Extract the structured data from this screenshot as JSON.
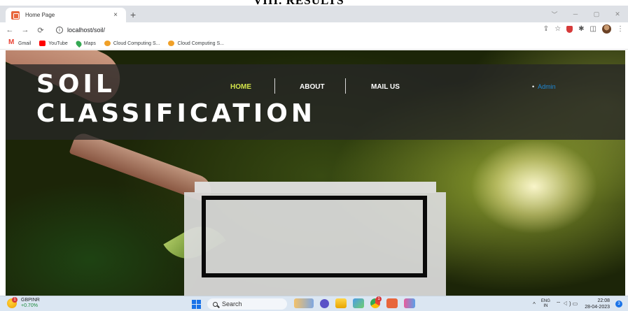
{
  "document": {
    "heading": "VIII.    RESULTS"
  },
  "browser": {
    "tab_title": "Home Page",
    "tab_close": "×",
    "new_tab": "+",
    "url": "localhost/soil/",
    "bookmarks": [
      {
        "label": "Gmail",
        "icon": "gmail-icon"
      },
      {
        "label": "YouTube",
        "icon": "youtube-icon"
      },
      {
        "label": "Maps",
        "icon": "maps-icon"
      },
      {
        "label": "Cloud Computing S...",
        "icon": "cloud-icon"
      },
      {
        "label": "Cloud Computing S...",
        "icon": "cloud-icon"
      }
    ]
  },
  "site": {
    "brand_line1": "SOIL",
    "brand_line2": "CLASSIFICATION",
    "nav": {
      "home": "HOME",
      "about": "ABOUT",
      "mail": "MAIL US"
    },
    "admin": "Admin",
    "colors": {
      "nav_active": "#d4e44a",
      "admin_link": "#1e88d6",
      "header_band": "#262626"
    }
  },
  "taskbar": {
    "ticker_symbol": "GBPINR",
    "ticker_change": "+0.70%",
    "weather_badge": "1",
    "search_label": "Search",
    "chrome_badge": "1",
    "lang_line1": "ENG",
    "lang_line2": "IN",
    "time": "22:08",
    "date": "28-04-2023",
    "notification_count": "3"
  }
}
